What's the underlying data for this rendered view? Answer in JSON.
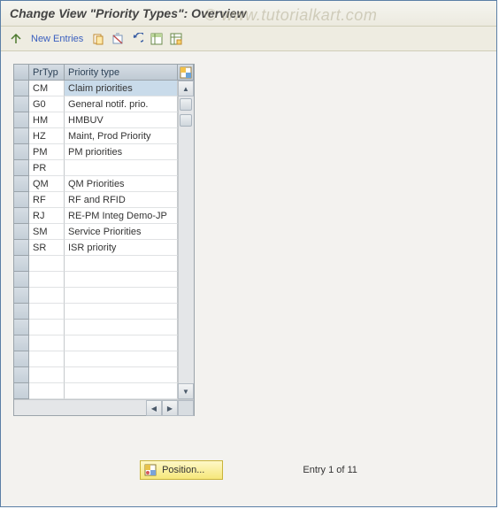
{
  "title": "Change View \"Priority Types\": Overview",
  "watermark": "© www.tutorialkart.com",
  "toolbar": {
    "new_entries": "New Entries"
  },
  "grid": {
    "header": {
      "code": "PrTyp",
      "text": "Priority type"
    },
    "rows": [
      {
        "code": "CM",
        "text": "Claim priorities",
        "selected": true
      },
      {
        "code": "G0",
        "text": "General notif. prio."
      },
      {
        "code": "HM",
        "text": "HMBUV"
      },
      {
        "code": "HZ",
        "text": "Maint, Prod Priority"
      },
      {
        "code": "PM",
        "text": "PM priorities"
      },
      {
        "code": "PR",
        "text": ""
      },
      {
        "code": "QM",
        "text": "QM Priorities"
      },
      {
        "code": "RF",
        "text": "RF and RFID"
      },
      {
        "code": "RJ",
        "text": "RE-PM Integ Demo-JP"
      },
      {
        "code": "SM",
        "text": "Service Priorities"
      },
      {
        "code": "SR",
        "text": "ISR priority"
      }
    ],
    "empty_rows": 9
  },
  "footer": {
    "position_label": "Position...",
    "entry_info": "Entry 1 of 11"
  }
}
